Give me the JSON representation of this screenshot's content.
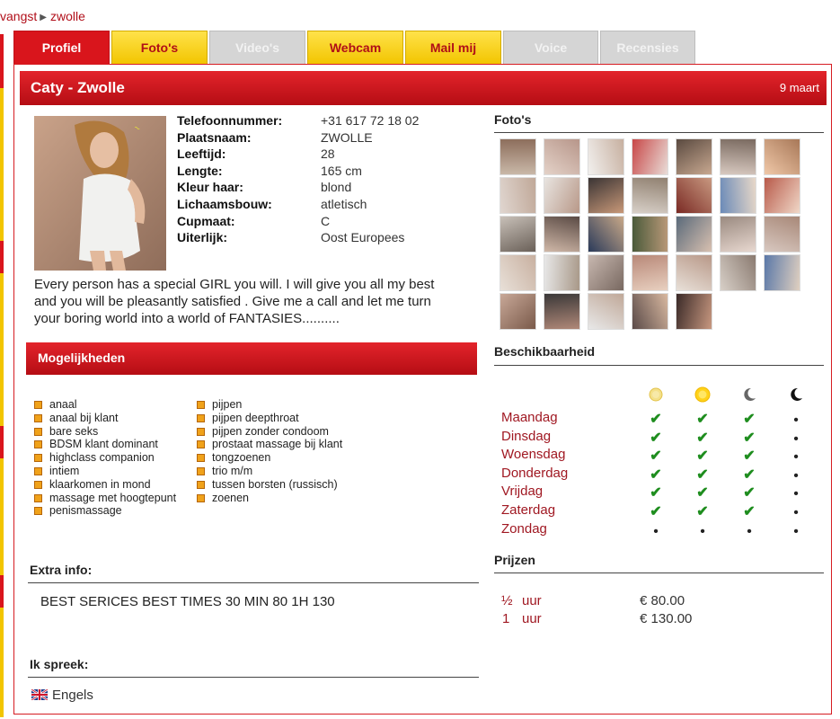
{
  "breadcrumb": {
    "prev": "vangst",
    "separator": "▶",
    "current": "zwolle"
  },
  "tabs": [
    {
      "label": "Profiel",
      "state": "active"
    },
    {
      "label": "Foto's",
      "state": "yellow"
    },
    {
      "label": "Video's",
      "state": "disabled"
    },
    {
      "label": "Webcam",
      "state": "yellow"
    },
    {
      "label": "Mail mij",
      "state": "yellow"
    },
    {
      "label": "Voice",
      "state": "disabled"
    },
    {
      "label": "Recensies",
      "state": "disabled"
    }
  ],
  "header": {
    "name": "Caty - Zwolle",
    "date": "9 maart"
  },
  "details": [
    {
      "label": "Telefoonnummer:",
      "value": "+31 617 72 18 02"
    },
    {
      "label": "Plaatsnaam:",
      "value": "ZWOLLE"
    },
    {
      "label": "Leeftijd:",
      "value": "28"
    },
    {
      "label": "Lengte:",
      "value": "165 cm"
    },
    {
      "label": "Kleur haar:",
      "value": "blond"
    },
    {
      "label": "Lichaamsbouw:",
      "value": "atletisch"
    },
    {
      "label": "Cupmaat:",
      "value": "C"
    },
    {
      "label": "Uiterlijk:",
      "value": "Oost Europees"
    }
  ],
  "bio": "Every person has a special GIRL you will. I will give you all my best and you will be pleasantly satisfied . Give me a call and let me turn your boring world into a world of FANTASIES..........",
  "mogelijkheden": {
    "title": "Mogelijkheden",
    "col1": [
      "anaal",
      "anaal bij klant",
      "bare seks",
      "BDSM klant dominant",
      "highclass companion",
      "intiem",
      "klaarkomen in mond",
      "massage met hoogtepunt",
      "penismassage"
    ],
    "col2": [
      "pijpen",
      "pijpen deepthroat",
      "pijpen zonder condoom",
      "prostaat massage bij klant",
      "tongzoenen",
      "trio m/m",
      "tussen borsten (russisch)",
      "zoenen"
    ]
  },
  "extra": {
    "title": "Extra info:",
    "text": "BEST SERICES BEST TIMES 30 MIN 80 1H 130"
  },
  "languages": {
    "title": "Ik spreek:",
    "items": [
      "Engels"
    ]
  },
  "photos": {
    "title": "Foto's",
    "count": 33
  },
  "availability": {
    "title": "Beschikbaarheid",
    "period_icons": [
      "sun-icon",
      "bright-sun-icon",
      "moon-icon",
      "dark-moon-icon"
    ],
    "days": [
      {
        "day": "Maandag",
        "slots": [
          true,
          true,
          true,
          false
        ]
      },
      {
        "day": "Dinsdag",
        "slots": [
          true,
          true,
          true,
          false
        ]
      },
      {
        "day": "Woensdag",
        "slots": [
          true,
          true,
          true,
          false
        ]
      },
      {
        "day": "Donderdag",
        "slots": [
          true,
          true,
          true,
          false
        ]
      },
      {
        "day": "Vrijdag",
        "slots": [
          true,
          true,
          true,
          false
        ]
      },
      {
        "day": "Zaterdag",
        "slots": [
          true,
          true,
          true,
          false
        ]
      },
      {
        "day": "Zondag",
        "slots": [
          false,
          false,
          false,
          false
        ]
      }
    ]
  },
  "prices": {
    "title": "Prijzen",
    "items": [
      {
        "amount": "½",
        "unit": "uur",
        "price": "€ 80.00"
      },
      {
        "amount": "1",
        "unit": "uur",
        "price": "€ 130.00"
      }
    ]
  },
  "colors": {
    "brand_red": "#d9151c",
    "tab_yellow": "#f2c500",
    "day_red": "#a01822",
    "check_green": "#1e8d1e"
  }
}
